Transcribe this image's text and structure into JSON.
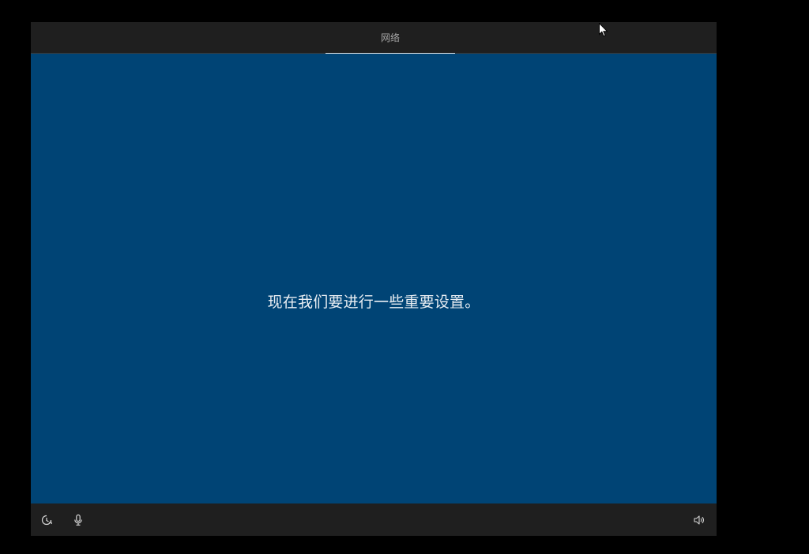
{
  "header": {
    "tabs": [
      {
        "label": "网络",
        "active": true
      }
    ]
  },
  "main": {
    "message": "现在我们要进行一些重要设置。"
  },
  "footer": {
    "left_icons": [
      "ease-of-access-icon",
      "microphone-icon"
    ],
    "right_icons": [
      "volume-icon"
    ]
  },
  "colors": {
    "page_background": "#000000",
    "bar_background": "#1f1f1f",
    "main_background": "#004475",
    "text": "#e9eef3",
    "tab_text": "#a6a6a6",
    "tab_underline": "#e8e8e8"
  }
}
